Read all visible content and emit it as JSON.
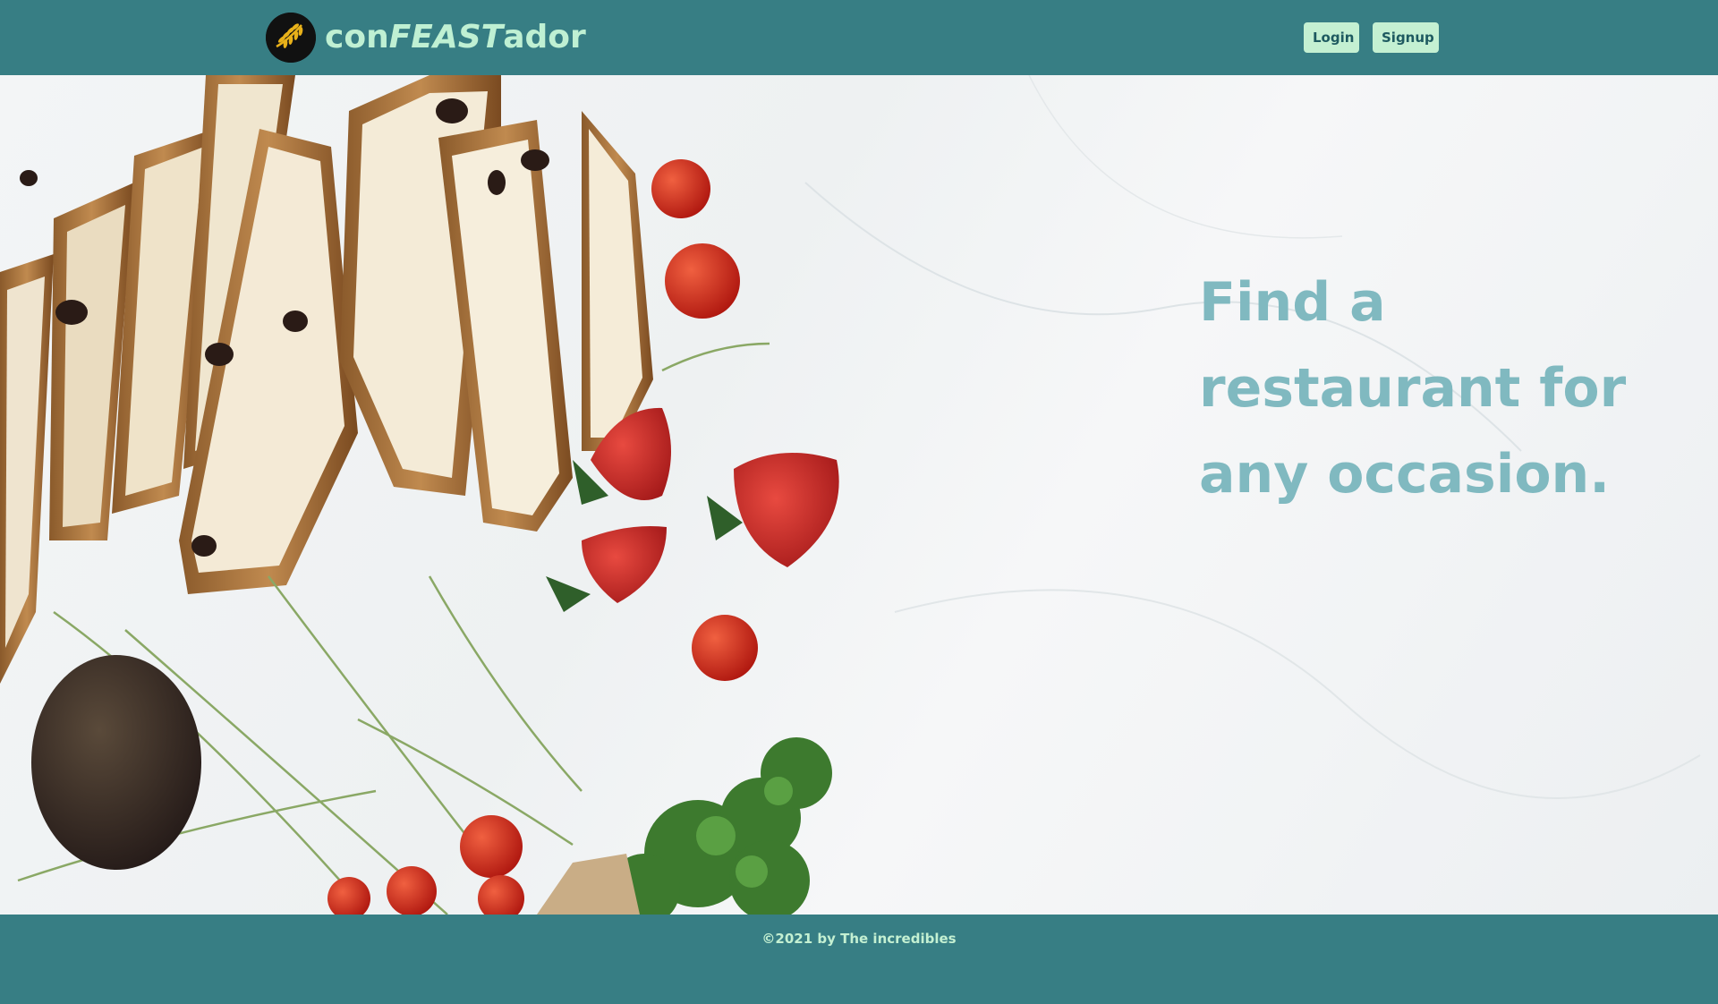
{
  "header": {
    "logo_icon": "wheat-icon",
    "brand": {
      "prefix": "con",
      "middle": "FEAST",
      "suffix": "ador"
    },
    "login_label": "Login",
    "signup_label": "Signup"
  },
  "hero": {
    "image": "food-flatlay-bread-strawberries-tomatoes-avocado-kale",
    "headline": "Find a restaurant for any occasion."
  },
  "footer": {
    "copyright": "©2021 by The incredibles"
  },
  "colors": {
    "header_bg": "#377e84",
    "brand_text": "#bff0d3",
    "button_bg": "#c4f0d2",
    "button_text": "#1e5a60",
    "headline": "#80b9c0",
    "marble": "#f3f5f6"
  }
}
